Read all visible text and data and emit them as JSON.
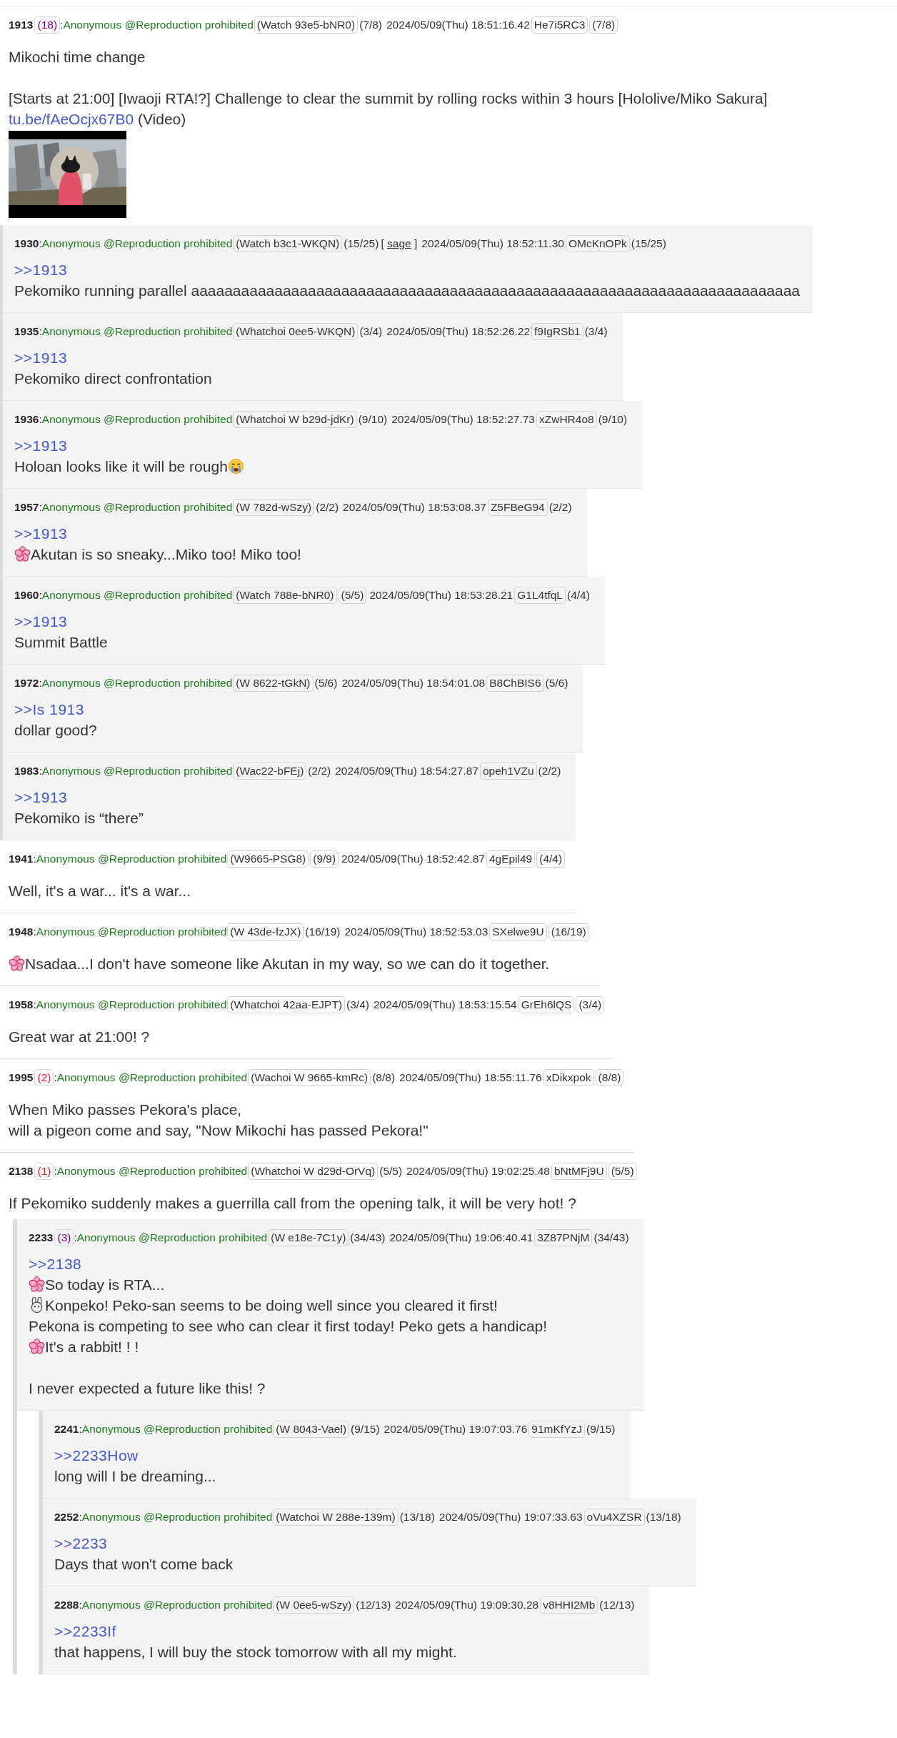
{
  "posts": [
    {
      "number": "1913",
      "reply_count": {
        "text": "(18)",
        "color": "#800080"
      },
      "separator": ":",
      "name": "Anonymous @Reproduction prohibited",
      "id": "(Watch 93e5-bNR0)",
      "id_count": {
        "text": "(7/8)",
        "boxed": false
      },
      "datetime": "2024/05/09(Thu) 18:51:16.42",
      "hash": "He7i5RC3",
      "hash_count": {
        "text": "(7/8)",
        "boxed": true
      },
      "body": [
        {
          "kind": "text",
          "text": "Mikochi time change"
        },
        {
          "kind": "blank"
        },
        {
          "kind": "text",
          "text": "[Starts at 21:00] [Iwaoji RTA!?] Challenge to clear the summit by rolling rocks within 3 hours [Hololive/Miko Sakura]"
        },
        {
          "kind": "link",
          "text": "tu.be/fAeOcjx67B0",
          "suffix": " (Video)"
        },
        {
          "kind": "picture"
        }
      ],
      "children": [
        {
          "number": "1930",
          "separator": ":",
          "name": "Anonymous @Reproduction prohibited",
          "id": "(Watch b3c1-WKQN)",
          "id_count": {
            "text": "(15/25)",
            "boxed": false
          },
          "sage": {
            "open": "[",
            "text": "sage",
            "close": "]"
          },
          "datetime": "2024/05/09(Thu) 18:52:11.30",
          "hash": "OMcKnOPk",
          "hash_count": {
            "text": "(15/25)",
            "boxed": false
          },
          "body": [
            {
              "kind": "anchor",
              "text": ">>1913"
            },
            {
              "kind": "text",
              "text": "Pekomiko running parallel aaaaaaaaaaaaaaaaaaaaaaaaaaaaaaaaaaaaaaaaaaaaaaaaaaaaaaaaaaaaaaaaaaaaaaaaa"
            }
          ]
        },
        {
          "number": "1935",
          "separator": ":",
          "name": "Anonymous @Reproduction prohibited",
          "id": "(Whatchoi 0ee5-WKQN)",
          "id_count": {
            "text": "(3/4)",
            "boxed": false
          },
          "datetime": "2024/05/09(Thu) 18:52:26.22",
          "hash": "f9IgRSb1",
          "hash_count": {
            "text": "(3/4)",
            "boxed": false
          },
          "body": [
            {
              "kind": "anchor",
              "text": ">>1913"
            },
            {
              "kind": "text",
              "text": "Pekomiko direct confrontation"
            }
          ]
        },
        {
          "number": "1936",
          "separator": ":",
          "name": "Anonymous @Reproduction prohibited",
          "id": "(Whatchoi W b29d-jdKr)",
          "id_count": {
            "text": "(9/10)",
            "boxed": false
          },
          "datetime": "2024/05/09(Thu) 18:52:27.73",
          "hash": "xZwHR4o8",
          "hash_count": {
            "text": "(9/10)",
            "boxed": false
          },
          "body": [
            {
              "kind": "anchor",
              "text": ">>1913"
            },
            {
              "kind": "crying",
              "text": "Holoan looks like it will be rough"
            }
          ]
        },
        {
          "number": "1957",
          "separator": ":",
          "name": "Anonymous @Reproduction prohibited",
          "id": "(W 782d-wSzy)",
          "id_count": {
            "text": "(2/2)",
            "boxed": false
          },
          "datetime": "2024/05/09(Thu) 18:53:08.37",
          "hash": "Z5FBeG94",
          "hash_count": {
            "text": "(2/2)",
            "boxed": false
          },
          "body": [
            {
              "kind": "anchor",
              "text": ">>1913"
            },
            {
              "kind": "flower",
              "text": "Akutan is so sneaky...Miko too! Miko too!"
            }
          ]
        },
        {
          "number": "1960",
          "separator": ":",
          "name": "Anonymous @Reproduction prohibited",
          "id": "(Watch 788e-bNR0)",
          "id_count": {
            "text": "(5/5)",
            "boxed": true
          },
          "datetime": "2024/05/09(Thu) 18:53:28.21",
          "hash": "G1L4tfqL",
          "hash_count": {
            "text": "(4/4)",
            "boxed": false
          },
          "body": [
            {
              "kind": "anchor",
              "text": ">>1913"
            },
            {
              "kind": "text",
              "text": "Summit Battle"
            }
          ]
        },
        {
          "number": "1972",
          "separator": ":",
          "name": "Anonymous @Reproduction prohibited",
          "id": "(W 8622-tGkN)",
          "id_count": {
            "text": "(5/6)",
            "boxed": false
          },
          "datetime": "2024/05/09(Thu) 18:54:01.08",
          "hash": "B8ChBIS6",
          "hash_count": {
            "text": "(5/6)",
            "boxed": false
          },
          "body": [
            {
              "kind": "anchor",
              "text": ">>Is 1913"
            },
            {
              "kind": "text",
              "text": "dollar good?"
            }
          ]
        },
        {
          "number": "1983",
          "separator": ":",
          "name": "Anonymous @Reproduction prohibited",
          "id": "(Wac22-bFEj)",
          "id_count": {
            "text": "(2/2)",
            "boxed": false
          },
          "datetime": "2024/05/09(Thu) 18:54:27.87",
          "hash": "opeh1VZu",
          "hash_count": {
            "text": "(2/2)",
            "boxed": false
          },
          "body": [
            {
              "kind": "anchor",
              "text": ">>1913"
            },
            {
              "kind": "text",
              "text": "Pekomiko is “there”"
            }
          ]
        }
      ]
    },
    {
      "number": "1941",
      "separator": ":",
      "name": "Anonymous @Reproduction prohibited",
      "id": "(W9665-PSG8)",
      "id_count": {
        "text": "(9/9)",
        "boxed": true
      },
      "datetime": "2024/05/09(Thu) 18:52:42.87",
      "hash": "4gEpil49",
      "hash_count": {
        "text": "(4/4)",
        "boxed": true
      },
      "body": [
        {
          "kind": "text",
          "text": "Well, it's a war... it's a war..."
        }
      ]
    },
    {
      "number": "1948",
      "separator": ":",
      "name": "Anonymous @Reproduction prohibited",
      "id": "(W 43de-fzJX)",
      "id_count": {
        "text": "(16/19)",
        "boxed": false
      },
      "datetime": "2024/05/09(Thu) 18:52:53.03",
      "hash": "SXelwe9U",
      "hash_count": {
        "text": "(16/19)",
        "boxed": true
      },
      "body": [
        {
          "kind": "flower",
          "text": "Nsadaa...I don't have someone like Akutan in my way, so we can do it together."
        }
      ]
    },
    {
      "number": "1958",
      "separator": ":",
      "name": "Anonymous @Reproduction prohibited",
      "id": "(Whatchoi 42aa-EJPT)",
      "id_count": {
        "text": "(3/4)",
        "boxed": false
      },
      "datetime": "2024/05/09(Thu) 18:53:15.54",
      "hash": "GrEh6lQS",
      "hash_count": {
        "text": "(3/4)",
        "boxed": true
      },
      "body": [
        {
          "kind": "text",
          "text": "Great war at 21:00! ?"
        }
      ]
    },
    {
      "number": "1995",
      "reply_count": {
        "text": "(2)",
        "color": "#e8202a"
      },
      "separator": ":",
      "name": "Anonymous @Reproduction prohibited",
      "id": "(Wachoi W 9665-kmRc)",
      "id_count": {
        "text": "(8/8)",
        "boxed": false
      },
      "datetime": "2024/05/09(Thu) 18:55:11.76",
      "hash": "xDikxpok",
      "hash_count": {
        "text": "(8/8)",
        "boxed": true
      },
      "body": [
        {
          "kind": "text",
          "text": "When Miko passes Pekora's place,"
        },
        {
          "kind": "text",
          "text": "will a pigeon come and say, \"Now Mikochi has passed Pekora!\""
        }
      ]
    },
    {
      "number": "2138",
      "reply_count": {
        "text": "(1)",
        "color": "#e8202a"
      },
      "separator": ":",
      "name": "Anonymous @Reproduction prohibited",
      "id": "(Whatchoi W d29d-OrVq)",
      "id_count": {
        "text": "(5/5)",
        "boxed": false
      },
      "datetime": "2024/05/09(Thu) 19:02:25.48",
      "hash": "bNtMFj9U",
      "hash_count": {
        "text": "(5/5)",
        "boxed": true
      },
      "body": [
        {
          "kind": "text",
          "text": "If Pekomiko suddenly makes a guerrilla call from the opening talk, it will be very hot! ?"
        }
      ],
      "children": [
        {
          "number": "2233",
          "reply_count": {
            "text": "(3)",
            "color": "#800080"
          },
          "separator": ":",
          "name": "Anonymous @Reproduction prohibited",
          "id": "(W e18e-7C1y)",
          "id_count": {
            "text": "(34/43)",
            "boxed": false
          },
          "datetime": "2024/05/09(Thu) 19:06:40.41",
          "hash": "3Z87PNjM",
          "hash_count": {
            "text": "(34/43)",
            "boxed": false
          },
          "body": [
            {
              "kind": "anchor",
              "text": ">>2138"
            },
            {
              "kind": "flower",
              "text": "So today is RTA..."
            },
            {
              "kind": "rabbit",
              "text": "Konpeko! Peko-san seems to be doing well since you cleared it first!"
            },
            {
              "kind": "text",
              "text": "Pekona is competing to see who can clear it first today! Peko gets a handicap!"
            },
            {
              "kind": "flower",
              "text": "It's a rabbit! ! !"
            },
            {
              "kind": "blank"
            },
            {
              "kind": "text",
              "text": "I never expected a future like this! ?"
            }
          ],
          "children": [
            {
              "number": "2241",
              "separator": ":",
              "name": "Anonymous @Reproduction prohibited",
              "id": "(W 8043-Vael)",
              "id_count": {
                "text": "(9/15)",
                "boxed": false
              },
              "datetime": "2024/05/09(Thu) 19:07:03.76",
              "hash": "91mKfYzJ",
              "hash_count": {
                "text": "(9/15)",
                "boxed": false
              },
              "body": [
                {
                  "kind": "anchor",
                  "text": ">>2233How"
                },
                {
                  "kind": "text",
                  "text": "long will I be dreaming..."
                }
              ]
            },
            {
              "number": "2252",
              "separator": ":",
              "name": "Anonymous @Reproduction prohibited",
              "id": "(Watchoi W 288e-139m)",
              "id_count": {
                "text": "(13/18)",
                "boxed": false
              },
              "datetime": "2024/05/09(Thu) 19:07:33.63",
              "hash": "oVu4XZSR",
              "hash_count": {
                "text": "(13/18)",
                "boxed": false
              },
              "body": [
                {
                  "kind": "anchor",
                  "text": ">>2233"
                },
                {
                  "kind": "text",
                  "text": "Days that won't come back"
                }
              ]
            },
            {
              "number": "2288",
              "separator": ":",
              "name": "Anonymous @Reproduction prohibited",
              "id": "(W 0ee5-wSzy)",
              "id_count": {
                "text": "(12/13)",
                "boxed": false
              },
              "datetime": "2024/05/09(Thu) 19:09:30.28",
              "hash": "v8HHI2Mb",
              "hash_count": {
                "text": "(12/13)",
                "boxed": false
              },
              "body": [
                {
                  "kind": "anchor",
                  "text": ">>2233If"
                },
                {
                  "kind": "text",
                  "text": "that happens, I will buy the stock tomorrow with all my might."
                }
              ]
            }
          ]
        }
      ]
    }
  ]
}
